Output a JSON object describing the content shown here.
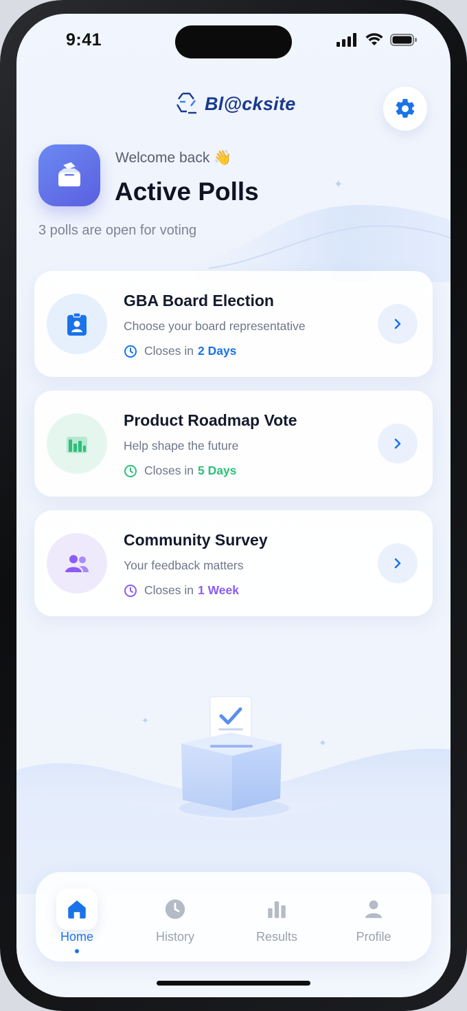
{
  "status_bar": {
    "time": "9:41"
  },
  "header": {
    "logo_text": "Bl@cksite"
  },
  "hero": {
    "welcome": "Welcome back 👋",
    "title": "Active Polls",
    "subtitle": "3 polls are open for voting"
  },
  "polls": [
    {
      "title": "GBA Board Election",
      "description": "Choose your board representative",
      "closes_prefix": "Closes in",
      "closes_value": "2 Days",
      "accent": "#1a73e8",
      "icon_bg": "#e6effc",
      "icon": "id-badge-icon"
    },
    {
      "title": "Product Roadmap Vote",
      "description": "Help shape the future",
      "closes_prefix": "Closes in",
      "closes_value": "5 Days",
      "accent": "#2ebf7a",
      "icon_bg": "#e5f6ee",
      "icon": "bar-chart-icon"
    },
    {
      "title": "Community Survey",
      "description": "Your feedback matters",
      "closes_prefix": "Closes in",
      "closes_value": "1 Week",
      "accent": "#8b5cf6",
      "icon_bg": "#efeafb",
      "icon": "users-icon"
    }
  ],
  "tabbar": {
    "tabs": [
      {
        "label": "Home",
        "icon": "home-icon",
        "active": true
      },
      {
        "label": "History",
        "icon": "clock-icon",
        "active": false
      },
      {
        "label": "Results",
        "icon": "bar-chart-icon",
        "active": false
      },
      {
        "label": "Profile",
        "icon": "user-icon",
        "active": false
      }
    ]
  },
  "colors": {
    "primary": "#1a73e8",
    "title_text": "#0f1424",
    "inactive_tab": "#9aa1ae"
  }
}
